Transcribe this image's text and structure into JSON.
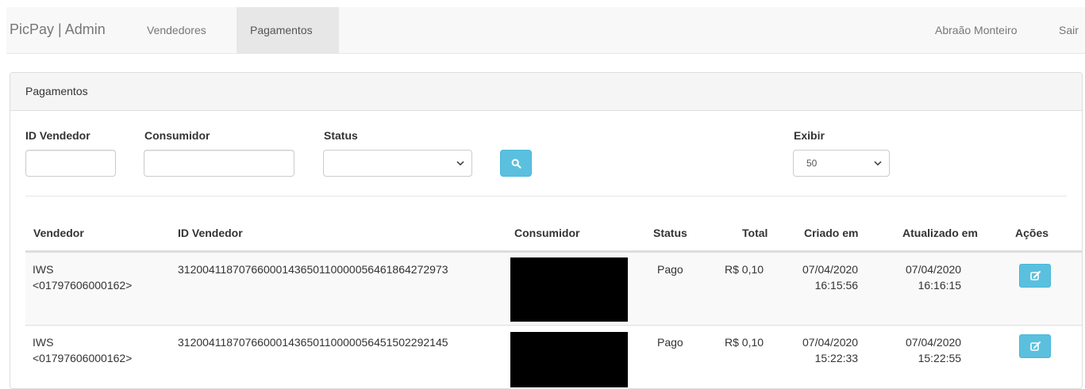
{
  "navbar": {
    "brand": "PicPay | Admin",
    "items": [
      {
        "label": "Vendedores",
        "active": false
      },
      {
        "label": "Pagamentos",
        "active": true
      }
    ],
    "user": "Abraão Monteiro",
    "logout": "Sair"
  },
  "panel": {
    "title": "Pagamentos"
  },
  "filters": {
    "id_vendedor_label": "ID Vendedor",
    "id_vendedor_value": "",
    "consumidor_label": "Consumidor",
    "consumidor_value": "",
    "status_label": "Status",
    "status_value": "",
    "search_icon": "search-icon",
    "exibir_label": "Exibir",
    "exibir_value": "50"
  },
  "table": {
    "columns": [
      "Vendedor",
      "ID Vendedor",
      "Consumidor",
      "Status",
      "Total",
      "Criado em",
      "Atualizado em",
      "Ações"
    ],
    "rows": [
      {
        "vendedor": "IWS",
        "vendedor_doc": "<01797606000162>",
        "id_vendedor": "312004118707660001436501100000564618642729​73",
        "consumidor": "",
        "status": "Pago",
        "total": "R$ 0,10",
        "criado_data": "07/04/2020",
        "criado_hora": "16:15:56",
        "atualizado_data": "07/04/2020",
        "atualizado_hora": "16:16:15",
        "action_icon": "edit-icon"
      },
      {
        "vendedor": "IWS",
        "vendedor_doc": "<01797606000162>",
        "id_vendedor": "31200411870766000143650110000056451502292145",
        "consumidor": "",
        "status": "Pago",
        "total": "R$ 0,10",
        "criado_data": "07/04/2020",
        "criado_hora": "15:22:33",
        "atualizado_data": "07/04/2020",
        "atualizado_hora": "15:22:55",
        "action_icon": "edit-icon"
      }
    ]
  },
  "colors": {
    "info": "#5bc0de",
    "navbar_bg": "#f8f8f8",
    "redaction": "#000000"
  }
}
